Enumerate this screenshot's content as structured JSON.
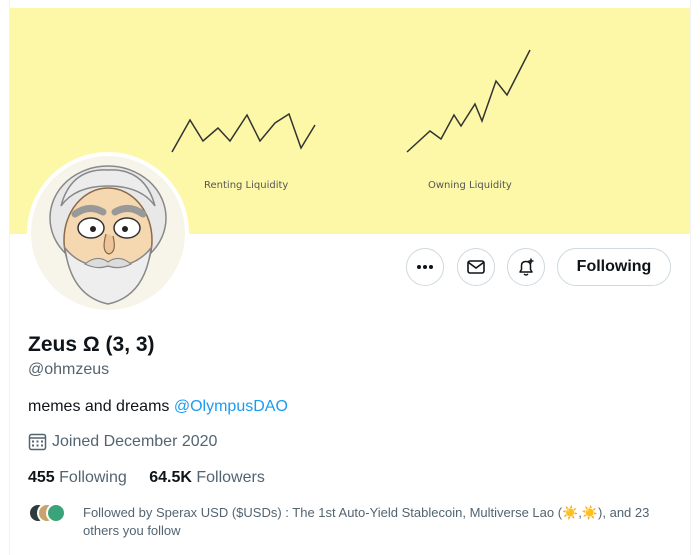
{
  "banner": {
    "left_caption": "Renting Liquidity",
    "right_caption": "Owning Liquidity"
  },
  "actions": {
    "more_icon": "more-icon",
    "message_icon": "mail-icon",
    "notify_icon": "bell-plus-icon",
    "following_label": "Following"
  },
  "profile": {
    "name": "Zeus Ω (3, 3)",
    "handle": "@ohmzeus",
    "bio_text": "memes and dreams",
    "bio_link": "@OlympusDAO",
    "joined": "Joined December 2020"
  },
  "stats": {
    "following_count": "455",
    "following_label": "Following",
    "followers_count": "64.5K",
    "followers_label": "Followers"
  },
  "followed_by": {
    "text": "Followed by Sperax USD ($USDs) : The 1st Auto-Yield Stablecoin, Multiverse Lao (☀️,☀️), and 23 others you follow"
  },
  "colors": {
    "banner_bg": "#fcf8a8",
    "link": "#1d9bf0",
    "secondary_text": "#536471"
  }
}
